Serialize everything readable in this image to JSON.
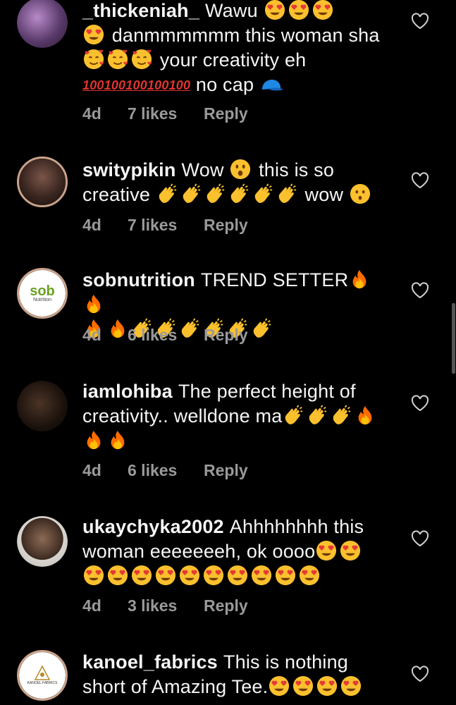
{
  "comments": [
    {
      "username": "_thickeniah_",
      "segments": [
        "Wawu",
        "danmmmmmm this woman sha",
        "your creativity eh",
        "no cap"
      ],
      "time": "4d",
      "likes": "7 likes",
      "reply": "Reply"
    },
    {
      "username": "switypikin",
      "segments": [
        "Wow",
        "this is so creative",
        "wow"
      ],
      "time": "4d",
      "likes": "7 likes",
      "reply": "Reply"
    },
    {
      "username": "sobnutrition",
      "segments": [
        "TREND SETTER"
      ],
      "avatar_text": "sob",
      "avatar_subtext": "Nutrition",
      "time": "4d",
      "likes": "6 likes",
      "reply": "Reply"
    },
    {
      "username": "iamlohiba",
      "segments": [
        "The perfect height of creativity.. welldone ma"
      ],
      "time": "4d",
      "likes": "6 likes",
      "reply": "Reply"
    },
    {
      "username": "ukaychyka2002",
      "segments": [
        "Ahhhhhhhh this woman eeeeeeeh, ok oooo"
      ],
      "time": "4d",
      "likes": "3 likes",
      "reply": "Reply"
    },
    {
      "username": "kanoel_fabrics",
      "segments": [
        "This is nothing short of Amazing Tee."
      ],
      "avatar_text": "KANOEL FABRICS",
      "time": "",
      "likes": "",
      "reply": ""
    }
  ],
  "hundred_label": "100",
  "colors": {
    "background": "#000000",
    "meta": "#9a9a9a",
    "accent_ring": "#c9a38a"
  }
}
